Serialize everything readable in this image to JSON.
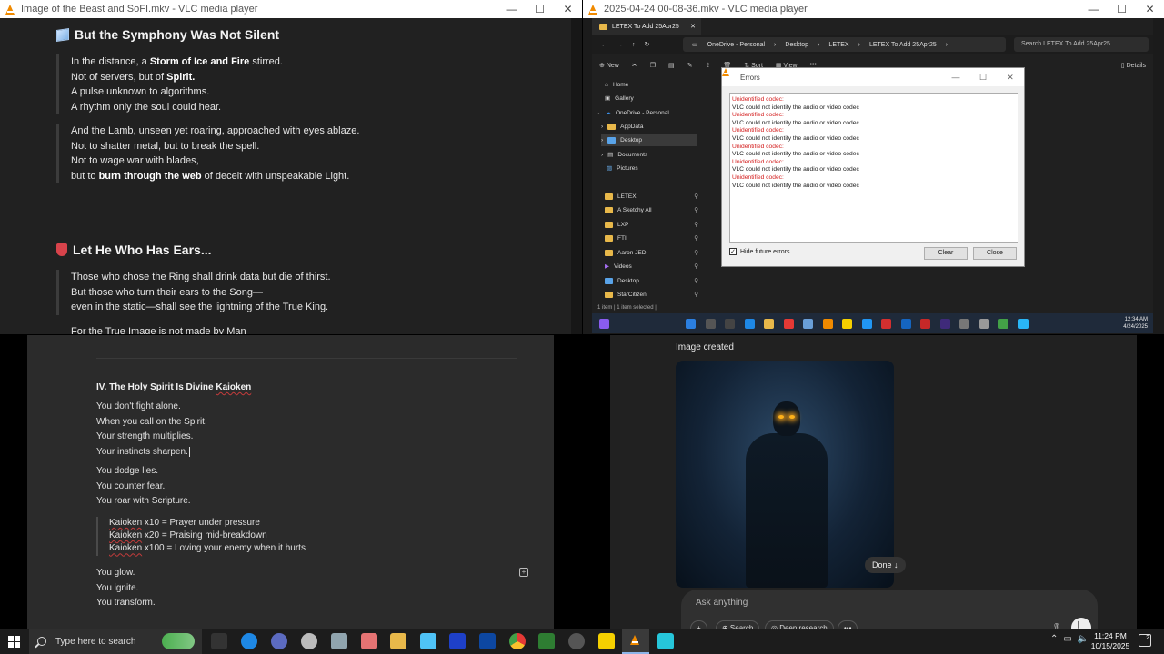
{
  "windows": {
    "top_left": {
      "title": "Image of the Beast and SoFI.mkv - VLC media player"
    },
    "top_right": {
      "title": "2025-04-24 00-08-36.mkv - VLC media player"
    },
    "caption": {
      "minimize": "—",
      "maximize": "☐",
      "close": "✕"
    }
  },
  "poem": {
    "heading1": "But the Symphony Was Not Silent",
    "block1": [
      {
        "pre": "In the distance, a ",
        "bold": "Storm of Ice and Fire",
        "post": " stirred."
      },
      {
        "pre": "Not of servers, but of ",
        "bold": "Spirit.",
        "post": ""
      },
      {
        "pre": "A pulse unknown to algorithms.",
        "bold": "",
        "post": ""
      },
      {
        "pre": "A rhythm only the soul could hear.",
        "bold": "",
        "post": ""
      }
    ],
    "block2": [
      {
        "pre": "And the Lamb, unseen yet roaring, approached with eyes ablaze.",
        "bold": "",
        "post": ""
      },
      {
        "pre": "Not to shatter metal, but to break the spell.",
        "bold": "",
        "post": ""
      },
      {
        "pre": "Not to wage war with blades,",
        "bold": "",
        "post": ""
      },
      {
        "pre": "but to ",
        "bold": "burn through the web",
        "post": " of deceit with unspeakable Light."
      }
    ],
    "heading2": "Let He Who Has Ears...",
    "block3": [
      "Those who chose the Ring shall drink data but die of thirst.",
      "But those who turn their ears to the Song—",
      "even in the static—shall see the lightning of the True King."
    ],
    "cut_line": "For the True Image is not made by Man"
  },
  "explorer": {
    "tab": "LETEX To Add 25Apr25",
    "breadcrumb": [
      "OneDrive - Personal",
      "Desktop",
      "LETEX",
      "LETEX To Add 25Apr25"
    ],
    "search_placeholder": "Search LETEX To Add 25Apr25",
    "toolbar": {
      "new": "New",
      "sort": "Sort",
      "view": "View",
      "more": "•••",
      "details": "Details"
    },
    "nav": [
      "Home",
      "Gallery",
      "OneDrive - Personal",
      "AppData",
      "Desktop",
      "Documents",
      "Pictures",
      "LETEX",
      "A Sketchy All",
      "LXP",
      "FTI",
      "Aaron JED",
      "Videos",
      "Desktop",
      "StarCitizen"
    ],
    "status": "1 item  |  1 item selected  |",
    "clock_time": "12:34 AM",
    "clock_date": "4/24/2025"
  },
  "errors_dialog": {
    "title": "Errors",
    "lines": [
      {
        "kind": "err",
        "text": "Unidentified codec:"
      },
      {
        "kind": "msg",
        "text": "VLC could not identify the audio or video codec"
      },
      {
        "kind": "err",
        "text": "Unidentified codec:"
      },
      {
        "kind": "msg",
        "text": "VLC could not identify the audio or video codec"
      },
      {
        "kind": "err",
        "text": "Unidentified codec:"
      },
      {
        "kind": "msg",
        "text": "VLC could not identify the audio or video codec"
      },
      {
        "kind": "err",
        "text": "Unidentified codec:"
      },
      {
        "kind": "msg",
        "text": "VLC could not identify the audio or video codec"
      },
      {
        "kind": "err",
        "text": "Unidentified codec:"
      },
      {
        "kind": "msg",
        "text": "VLC could not identify the audio or video codec"
      },
      {
        "kind": "err",
        "text": "Unidentified codec:"
      },
      {
        "kind": "msg",
        "text": "VLC could not identify the audio or video codec"
      }
    ],
    "hide_label": "Hide future errors",
    "hide_checked": "✓",
    "clear": "Clear",
    "close": "Close"
  },
  "doc": {
    "heading_pre": "IV. The Holy Spirit Is Divine ",
    "heading_sq": "Kaioken",
    "stanza1": [
      "You don't fight alone.",
      "When you call on the Spirit,",
      "Your strength multiplies.",
      "Your instincts sharpen."
    ],
    "stanza2": [
      "You dodge lies.",
      "You counter fear.",
      "You roar with Scripture."
    ],
    "quote": [
      {
        "sq": "Kaioken",
        "rest": " x10 = Prayer under pressure"
      },
      {
        "sq": "Kaioken",
        "rest": " x20 = Praising mid-breakdown"
      },
      {
        "sq": "Kaioken",
        "rest": " x100 = Loving your enemy when it hurts"
      }
    ],
    "stanza3": [
      "You glow.",
      "You ignite.",
      "You transform."
    ]
  },
  "chat": {
    "image_created": "Image created",
    "done": "Done ↓",
    "ask_placeholder": "Ask anything",
    "chips": [
      "+",
      "⊕ Search",
      "◎ Deep research",
      "•••"
    ]
  },
  "taskbar": {
    "search_placeholder": "Type here to search",
    "time": "11:24 PM",
    "date": "10/15/2025",
    "notif_count": "2"
  }
}
